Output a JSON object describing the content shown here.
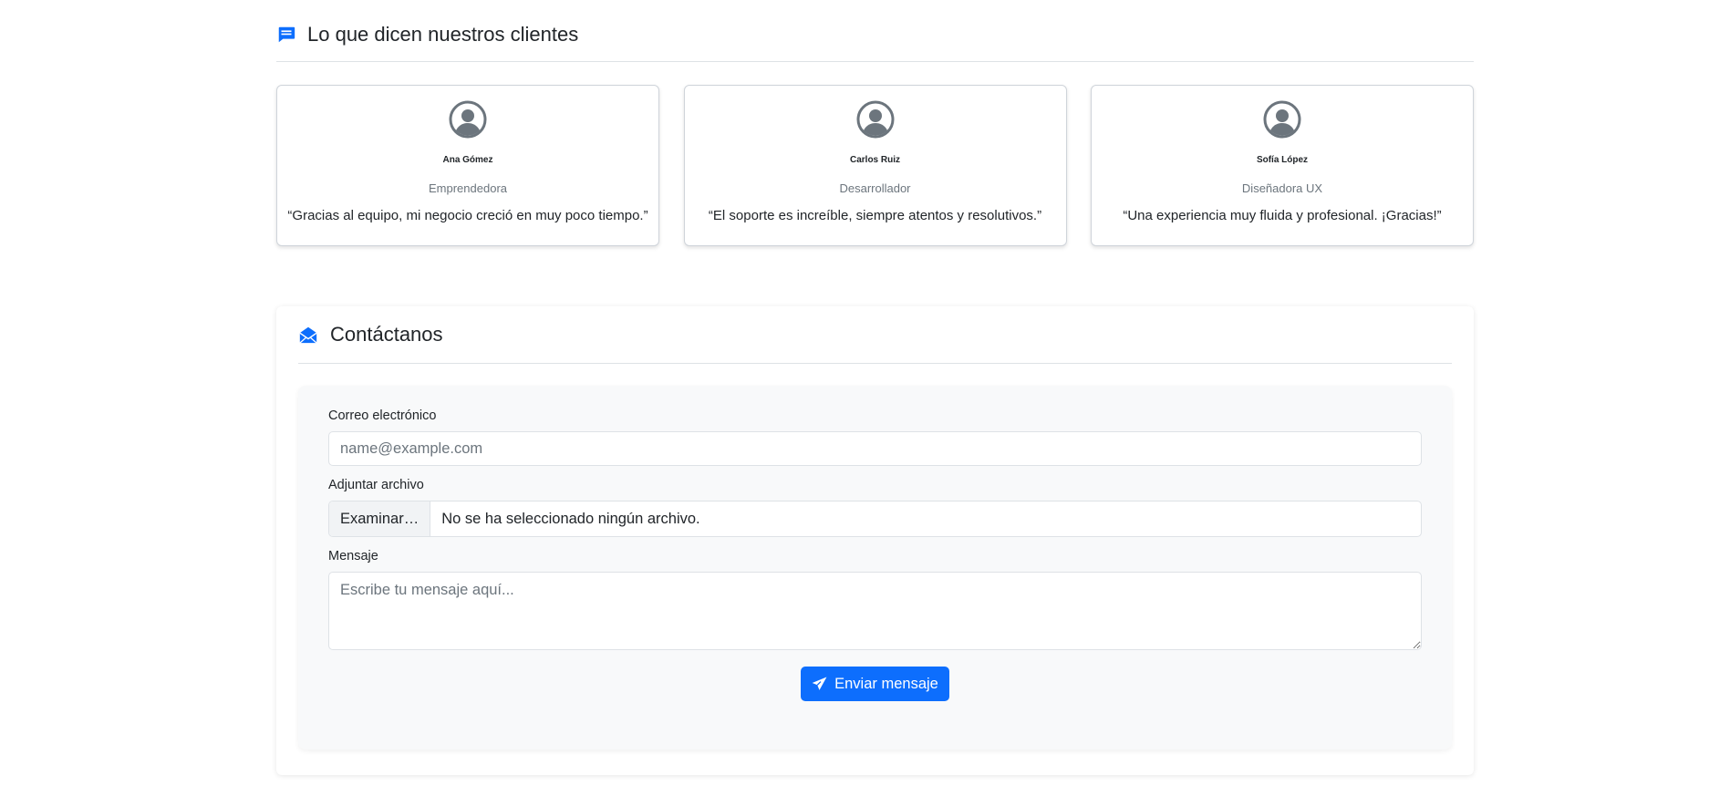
{
  "testimonials": {
    "title": "Lo que dicen nuestros clientes",
    "icon": "chat-bubble-icon",
    "items": [
      {
        "name": "Ana Gómez",
        "role": "Emprendedora",
        "quote": "“Gracias al equipo, mi negocio creció en muy poco tiempo.”"
      },
      {
        "name": "Carlos Ruiz",
        "role": "Desarrollador",
        "quote": "“El soporte es increíble, siempre atentos y resolutivos.”"
      },
      {
        "name": "Sofía López",
        "role": "Diseñadora UX",
        "quote": "“Una experiencia muy fluida y profesional. ¡Gracias!”"
      }
    ]
  },
  "contact": {
    "title": "Contáctanos",
    "icon": "envelope-open-icon",
    "email_label": "Correo electrónico",
    "email_placeholder": "name@example.com",
    "file_label": "Adjuntar archivo",
    "file_button": "Examinar…",
    "file_status": "No se ha seleccionado ningún archivo.",
    "message_label": "Mensaje",
    "message_placeholder": "Escribe tu mensaje aquí...",
    "submit_label": "Enviar mensaje"
  },
  "colors": {
    "accent": "#0d6efd",
    "muted": "#6c757d",
    "border": "#dee2e6"
  }
}
